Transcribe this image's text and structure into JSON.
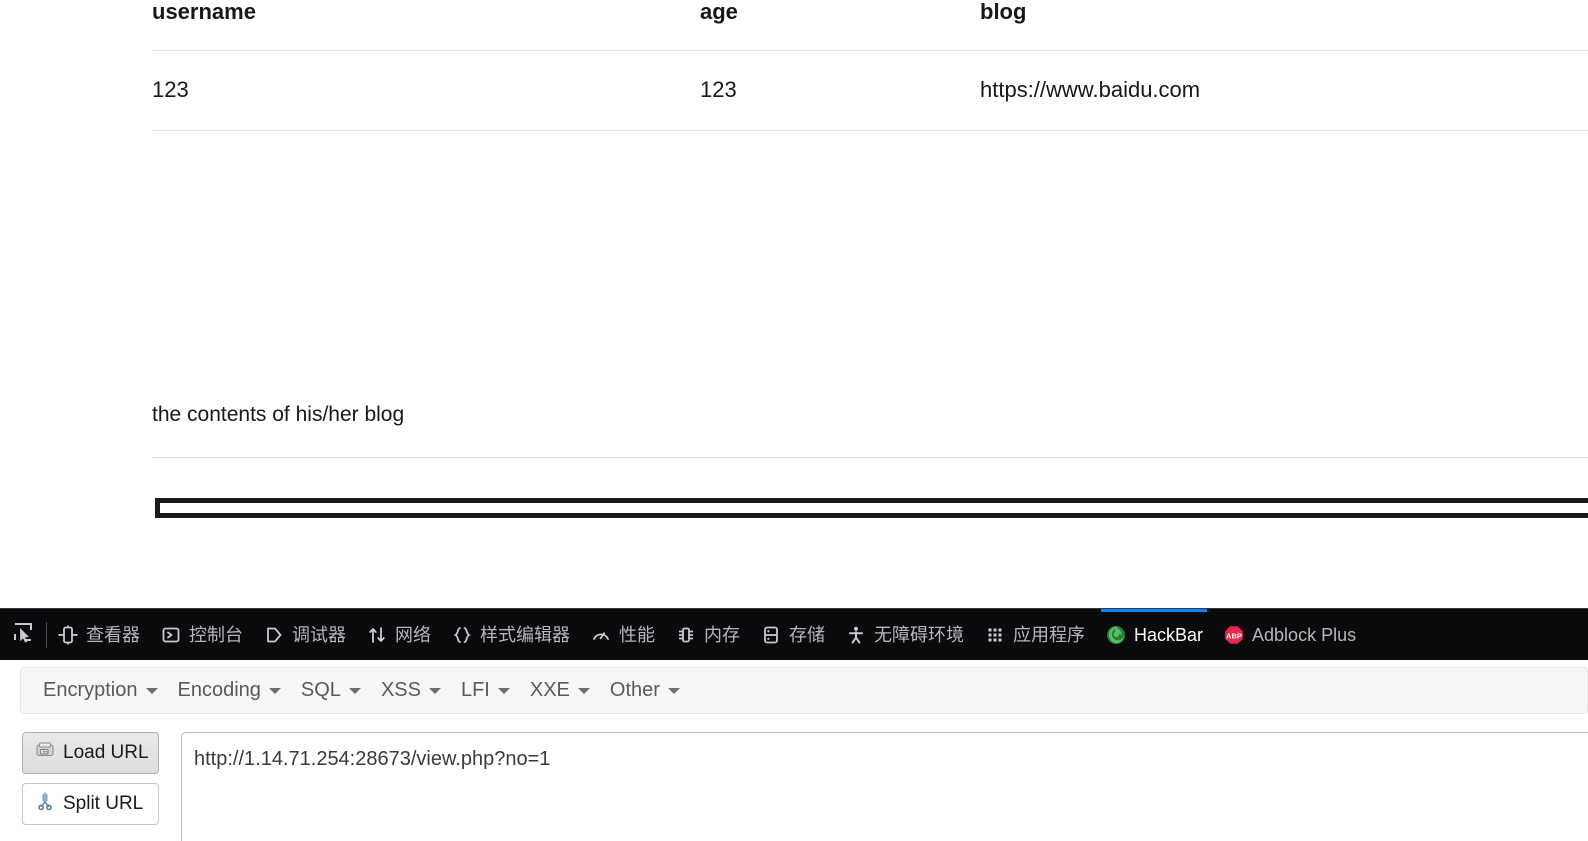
{
  "page": {
    "table": {
      "headers": [
        "username",
        "age",
        "blog"
      ],
      "rows": [
        {
          "username": "123",
          "age": "123",
          "blog": "https://www.baidu.com"
        }
      ]
    },
    "blog_body_text": "the contents of his/her blog"
  },
  "devtools": {
    "picker_icon": "element-picker-icon",
    "tabs": [
      {
        "label": "查看器",
        "icon": "inspector-icon",
        "active": false
      },
      {
        "label": "控制台",
        "icon": "console-icon",
        "active": false
      },
      {
        "label": "调试器",
        "icon": "debugger-icon",
        "active": false
      },
      {
        "label": "网络",
        "icon": "network-icon",
        "active": false
      },
      {
        "label": "样式编辑器",
        "icon": "style-editor-icon",
        "active": false
      },
      {
        "label": "性能",
        "icon": "performance-icon",
        "active": false
      },
      {
        "label": "内存",
        "icon": "memory-icon",
        "active": false
      },
      {
        "label": "存储",
        "icon": "storage-icon",
        "active": false
      },
      {
        "label": "无障碍环境",
        "icon": "accessibility-icon",
        "active": false
      },
      {
        "label": "应用程序",
        "icon": "application-icon",
        "active": false
      },
      {
        "label": "HackBar",
        "icon": "hackbar-icon",
        "active": true
      },
      {
        "label": "Adblock Plus",
        "icon": "adblock-plus-icon",
        "active": false
      }
    ],
    "active_tab_accent": "#0a84ff"
  },
  "hackbar": {
    "menus": [
      {
        "label": "Encryption"
      },
      {
        "label": "Encoding"
      },
      {
        "label": "SQL"
      },
      {
        "label": "XSS"
      },
      {
        "label": "LFI"
      },
      {
        "label": "XXE"
      },
      {
        "label": "Other"
      }
    ],
    "buttons": [
      {
        "label": "Load URL",
        "icon": "load-url-disk-icon"
      },
      {
        "label": "Split URL",
        "icon": "split-url-scissors-icon"
      }
    ],
    "url_value": "http://1.14.71.254:28673/view.php?no=1",
    "url_placeholder": ""
  }
}
